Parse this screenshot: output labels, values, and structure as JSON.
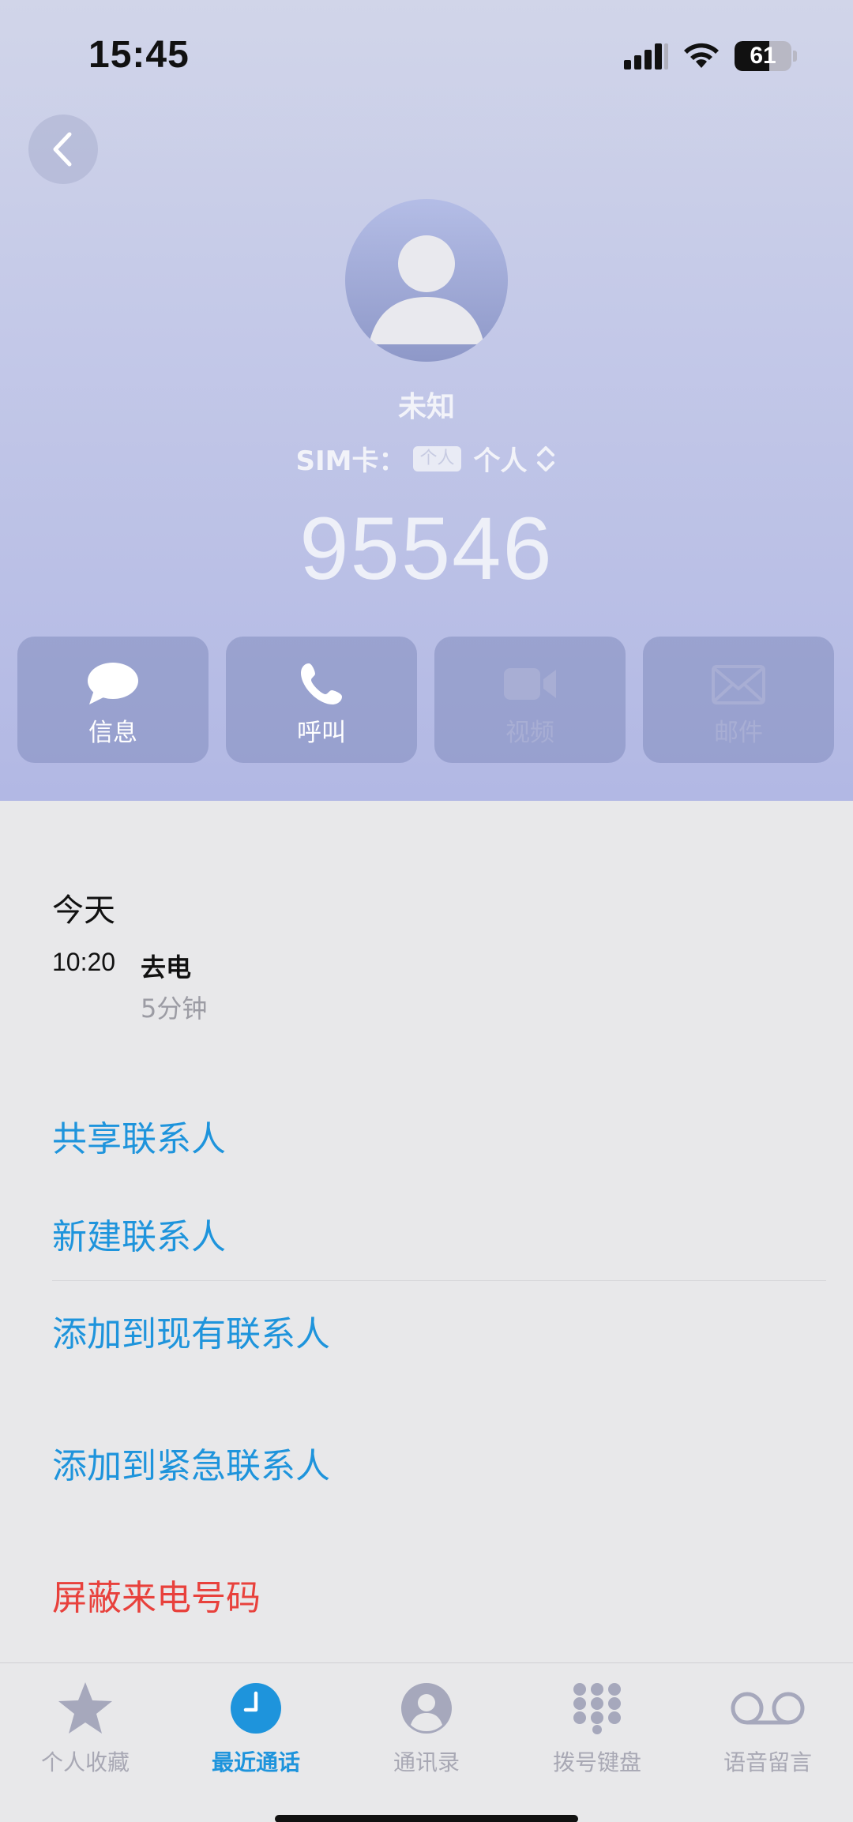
{
  "status_bar": {
    "time": "15:45",
    "battery": 61,
    "battery_label": "61"
  },
  "contact": {
    "name": "未知",
    "sim_label": "SIM卡：",
    "sim_badge": "个人",
    "sim_value": "个人",
    "number": "95546"
  },
  "actions": [
    {
      "label": "信息",
      "icon": "message-icon",
      "enabled": true
    },
    {
      "label": "呼叫",
      "icon": "phone-icon",
      "enabled": true
    },
    {
      "label": "视频",
      "icon": "video-icon",
      "enabled": false
    },
    {
      "label": "邮件",
      "icon": "mail-icon",
      "enabled": false
    }
  ],
  "history": {
    "date": "今天",
    "time": "10:20",
    "type": "去电",
    "duration": "5分钟"
  },
  "options": {
    "share": "共享联系人",
    "new": "新建联系人",
    "add_existing": "添加到现有联系人",
    "add_emergency": "添加到紧急联系人",
    "block": "屏蔽来电号码"
  },
  "colors": {
    "accent": "#1e94dc",
    "danger": "#e8413c"
  },
  "tabs": [
    {
      "label": "个人收藏",
      "icon": "star-icon",
      "active": false
    },
    {
      "label": "最近通话",
      "icon": "clock-icon",
      "active": true
    },
    {
      "label": "通讯录",
      "icon": "contacts-icon",
      "active": false
    },
    {
      "label": "拨号键盘",
      "icon": "keypad-icon",
      "active": false
    },
    {
      "label": "语音留言",
      "icon": "voicemail-icon",
      "active": false
    }
  ]
}
